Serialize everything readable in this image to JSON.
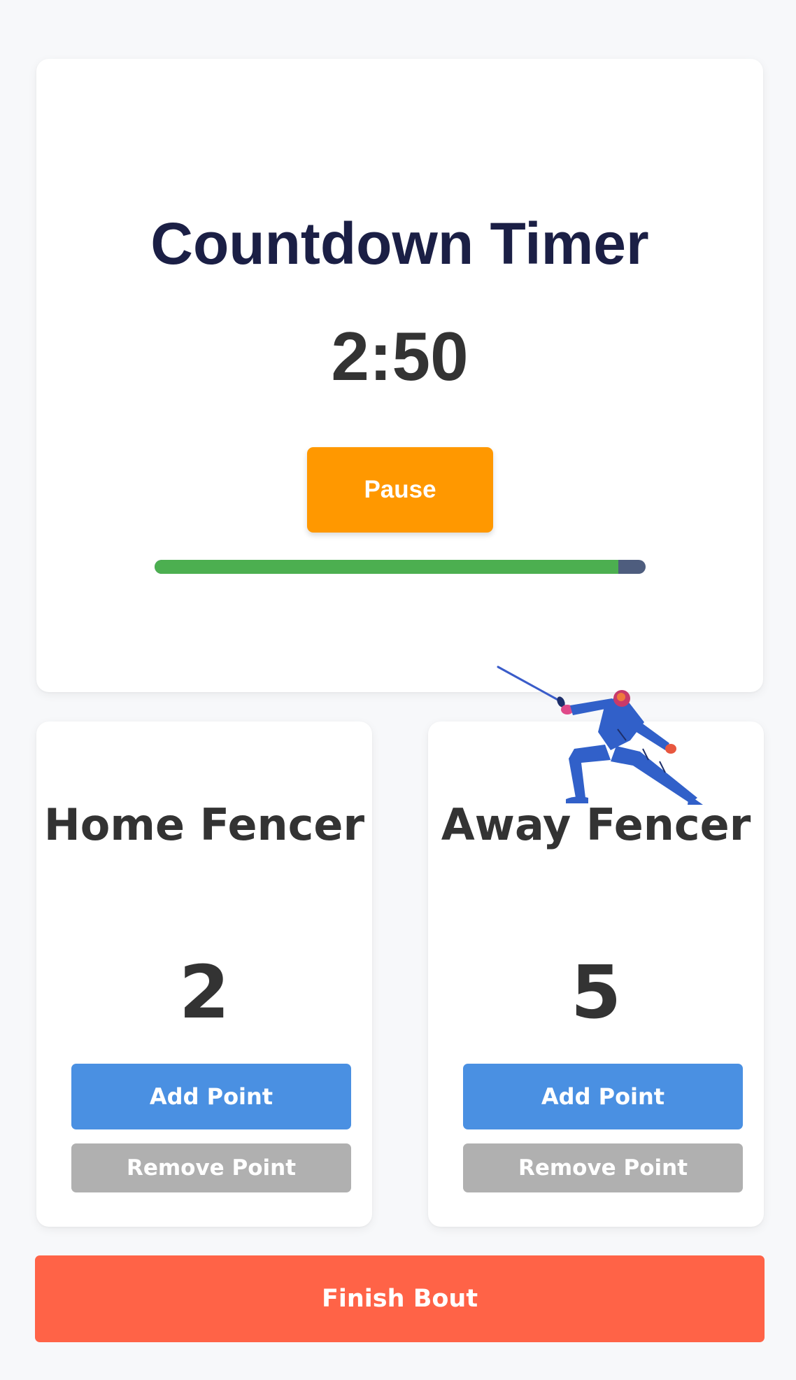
{
  "timer": {
    "title": "Countdown Timer",
    "value": "2:50",
    "pause_label": "Pause",
    "progress": 0.944
  },
  "home": {
    "name": "Home Fencer",
    "score": "2",
    "add_label": "Add Point",
    "remove_label": "Remove Point"
  },
  "away": {
    "name": "Away Fencer",
    "score": "5",
    "add_label": "Add Point",
    "remove_label": "Remove Point"
  },
  "finish_label": "Finish Bout",
  "colors": {
    "pause": "#ff9800",
    "progress_fill": "#4caf50",
    "progress_track": "#4e5d7e",
    "add": "#4a90e2",
    "remove": "#b0b0b0",
    "finish": "#ff6347",
    "fencer_suit": "#3160c9"
  },
  "illustration": {
    "icon": "fencer-illustration"
  }
}
